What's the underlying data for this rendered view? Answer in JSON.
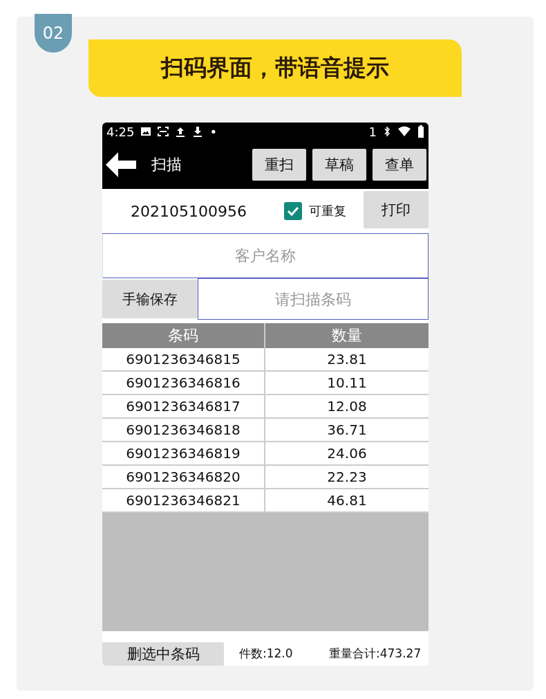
{
  "badge": "02",
  "banner": "扫码界面，带语音提示",
  "status_bar": {
    "time": "4:25",
    "dot": "•",
    "sim": "1"
  },
  "toolbar": {
    "title": "扫描",
    "buttons": [
      "重扫",
      "草稿",
      "查单"
    ]
  },
  "order": {
    "number": "202105100956",
    "repeatable": {
      "label": "可重复",
      "checked": true
    },
    "print_button": "打印"
  },
  "customer_field": {
    "placeholder": "客户名称"
  },
  "manual_save_button": "手输保存",
  "barcode_field": {
    "placeholder": "请扫描条码"
  },
  "table": {
    "columns": [
      "条码",
      "数量"
    ],
    "rows": [
      {
        "barcode": "6901236346815",
        "quantity": "23.81"
      },
      {
        "barcode": "6901236346816",
        "quantity": "10.11"
      },
      {
        "barcode": "6901236346817",
        "quantity": "12.08"
      },
      {
        "barcode": "6901236346818",
        "quantity": "36.71"
      },
      {
        "barcode": "6901236346819",
        "quantity": "24.06"
      },
      {
        "barcode": "6901236346820",
        "quantity": "22.23"
      },
      {
        "barcode": "6901236346821",
        "quantity": "46.81"
      }
    ]
  },
  "footer": {
    "delete_button": "删选中条码",
    "count": "件数:12.0",
    "weight_total": "重量合计:473.27"
  }
}
